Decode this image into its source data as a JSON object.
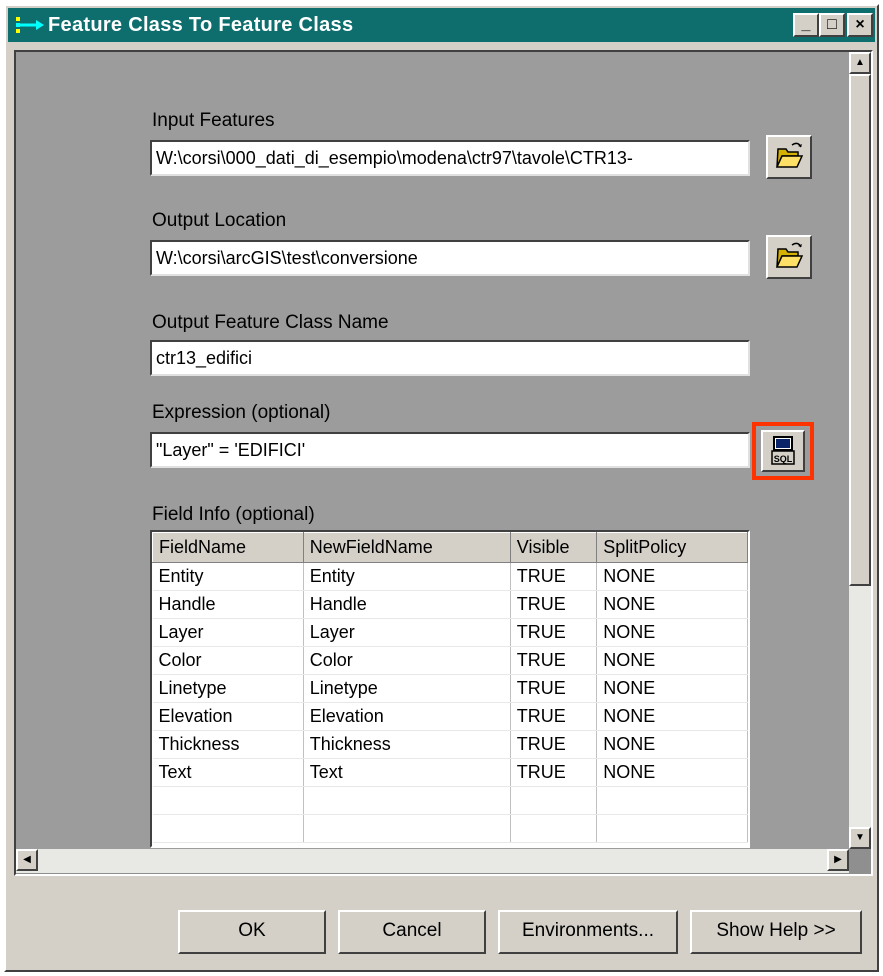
{
  "window": {
    "title": "Feature Class To Feature Class",
    "controls": {
      "minimize": "_",
      "maximize": "□",
      "close": "×"
    }
  },
  "form": {
    "input_features": {
      "label": "Input Features",
      "value": "W:\\corsi\\000_dati_di_esempio\\modena\\ctr97\\tavole\\CTR13-"
    },
    "output_location": {
      "label": "Output Location",
      "value": "W:\\corsi\\arcGIS\\test\\conversione"
    },
    "output_name": {
      "label": "Output Feature Class Name",
      "value": "ctr13_edifici"
    },
    "expression": {
      "label": "Expression (optional)",
      "value": "\"Layer\" = 'EDIFICI'",
      "sql_button": "SQL"
    },
    "field_info": {
      "label": "Field Info (optional)",
      "columns": [
        "FieldName",
        "NewFieldName",
        "Visible",
        "SplitPolicy"
      ],
      "rows": [
        [
          "Entity",
          "Entity",
          "TRUE",
          "NONE"
        ],
        [
          "Handle",
          "Handle",
          "TRUE",
          "NONE"
        ],
        [
          "Layer",
          "Layer",
          "TRUE",
          "NONE"
        ],
        [
          "Color",
          "Color",
          "TRUE",
          "NONE"
        ],
        [
          "Linetype",
          "Linetype",
          "TRUE",
          "NONE"
        ],
        [
          "Elevation",
          "Elevation",
          "TRUE",
          "NONE"
        ],
        [
          "Thickness",
          "Thickness",
          "TRUE",
          "NONE"
        ],
        [
          "Text",
          "Text",
          "TRUE",
          "NONE"
        ],
        [
          "",
          "",
          "",
          ""
        ],
        [
          "",
          "",
          "",
          ""
        ]
      ]
    }
  },
  "buttons": {
    "ok": "OK",
    "cancel": "Cancel",
    "environments": "Environments...",
    "show_help": "Show Help >>"
  },
  "colors": {
    "title_bar": "#0e6e6e",
    "highlight": "#ff3300",
    "dialog": "#d4d0c8"
  },
  "icons": [
    "folder-open-icon",
    "sql-icon",
    "app-icon"
  ]
}
